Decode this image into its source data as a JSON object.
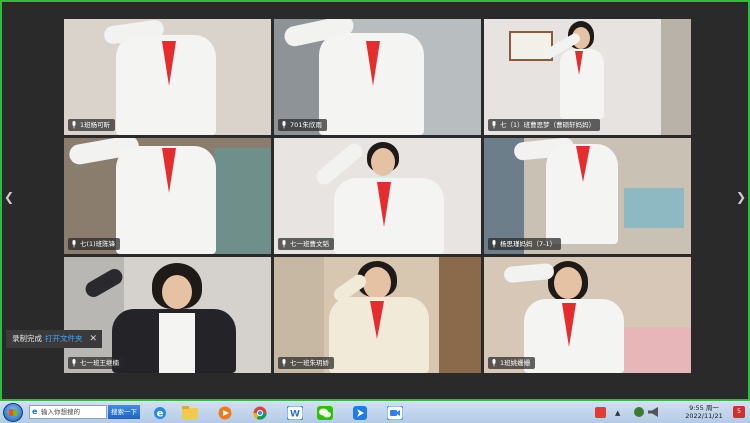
{
  "meeting": {
    "participants": [
      {
        "name": "1班杨可昕"
      },
      {
        "name": "701朱欣雨"
      },
      {
        "name": "七（1）班曹思梦（曹硕轩妈妈）"
      },
      {
        "name": "七(1)班陈锋"
      },
      {
        "name": "七一班曹文韬"
      },
      {
        "name": "杨思瑾妈妈（7-1）"
      },
      {
        "name": "七一班王继楠"
      },
      {
        "name": "七一班朱玥娇"
      },
      {
        "name": "1班姚姗姗"
      }
    ]
  },
  "toast": {
    "message": "录制完成",
    "link": "打开文件夹",
    "close": "✕"
  },
  "taskbar": {
    "search_placeholder": "输入你想搜的",
    "search_button": "搜索一下",
    "clock_time": "9:55 周一",
    "clock_date": "2022/11/21",
    "notification_count": "5",
    "apps": [
      "ie-icon",
      "file-explorer-icon",
      "media-player-icon",
      "chrome-icon",
      "wps-icon",
      "wechat-icon",
      "arrow-app-icon",
      "tencent-meeting-icon"
    ]
  },
  "colors": {
    "frame_border": "#2dbf3c",
    "scarf_red": "#e52d2d",
    "taskbar": "#c4d7ee"
  }
}
